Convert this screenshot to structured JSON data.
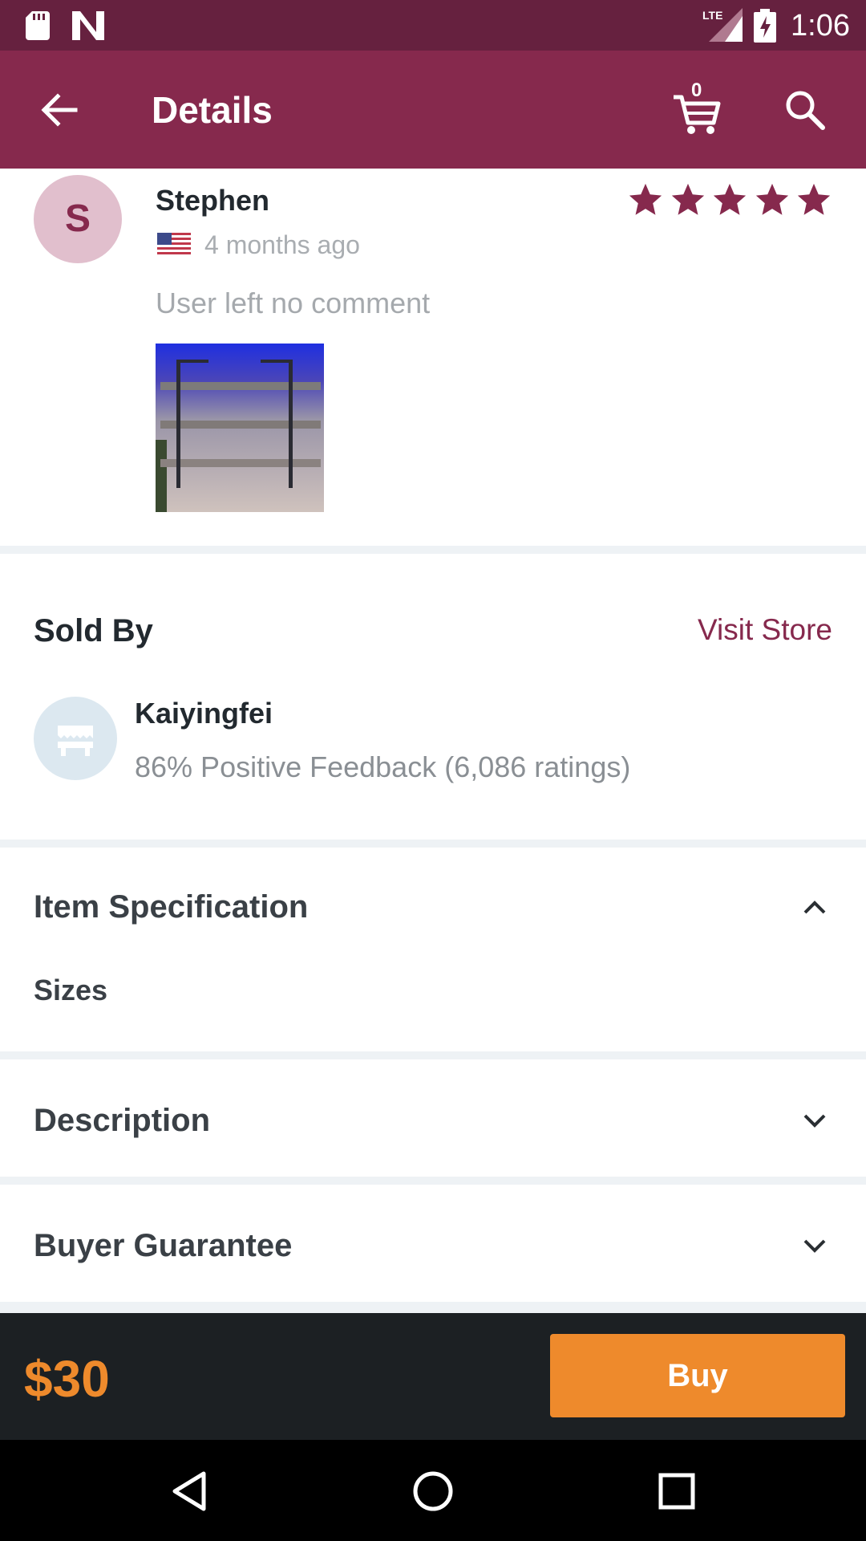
{
  "status_bar": {
    "time": "1:06",
    "network": "LTE",
    "icons": [
      "sd-card-icon",
      "n-icon",
      "lte-signal-icon",
      "battery-charging-icon"
    ]
  },
  "app_bar": {
    "title": "Details",
    "cart_count": "0",
    "icons": [
      "back-arrow-icon",
      "cart-icon",
      "search-icon"
    ]
  },
  "review": {
    "avatar_letter": "S",
    "reviewer_name": "Stephen",
    "date": "4 months ago",
    "flag": "us-flag-icon",
    "rating": 5,
    "rating_max": 5,
    "comment": "User left no comment"
  },
  "seller": {
    "section_title": "Sold By",
    "visit_store_label": "Visit Store",
    "store_name": "Kaiyingfei",
    "feedback": "86% Positive Feedback (6,086 ratings)"
  },
  "item_specification": {
    "title": "Item Specification",
    "expanded": true,
    "sizes_label": "Sizes"
  },
  "description": {
    "title": "Description",
    "expanded": false
  },
  "buyer_guarantee": {
    "title": "Buyer Guarantee",
    "expanded": false
  },
  "buy_bar": {
    "price": "$30",
    "buy_label": "Buy"
  },
  "colors": {
    "status_bar": "#66213f",
    "app_bar": "#86294d",
    "accent": "#86294d",
    "price": "#ee8a2c",
    "buy_button": "#ee8a2c",
    "buy_bar": "#1c2023"
  }
}
